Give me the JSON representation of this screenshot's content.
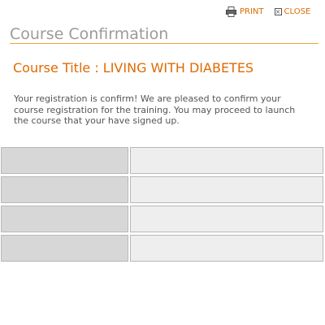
{
  "toolbar": {
    "print_label": "PRINT",
    "close_label": "CLOSE"
  },
  "page_title": "Course Confirmation",
  "course_title": "Course Title : LIVING WITH DIABETES",
  "message": "Your registration is confirm! We are pleased to confirm your course registration for the training. You may proceed to launch the course that your have signed up.",
  "details": {
    "rows": [
      {
        "label": "",
        "value": ""
      },
      {
        "label": "",
        "value": ""
      },
      {
        "label": "",
        "value": ""
      },
      {
        "label": "",
        "value": ""
      }
    ]
  },
  "colors": {
    "accent": "#e06a00",
    "title_gray": "#9b9b9b",
    "rule": "#e8a43a",
    "label_cell": "#d7d7d7",
    "value_cell": "#eeeeee"
  },
  "icons": {
    "print": "printer-icon",
    "close": "close-icon"
  }
}
